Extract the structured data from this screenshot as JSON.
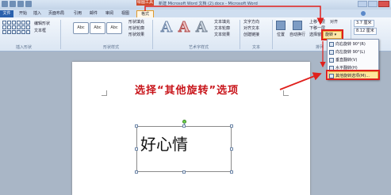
{
  "window": {
    "context_tab": "绘图工具",
    "title": "新建 Microsoft Word 文档 (2).docx - Microsoft Word"
  },
  "tabs": {
    "file": "文件",
    "home": "开始",
    "insert": "插入",
    "page_layout": "页面布局",
    "references": "引用",
    "mailings": "邮件",
    "review": "审阅",
    "view": "视图",
    "format": "格式"
  },
  "ribbon": {
    "insert_shapes": {
      "label": "插入形状",
      "edit_shape": "编辑形状",
      "text_box": "文本框"
    },
    "shape_styles": {
      "label": "形状样式",
      "presets": [
        "Abc",
        "Abc",
        "Abc"
      ],
      "fill": "形状填充",
      "outline": "形状轮廓",
      "effects": "形状效果"
    },
    "wordart_styles": {
      "label": "艺术字样式",
      "letters": [
        "A",
        "A",
        "A"
      ],
      "text_fill": "文本填充",
      "text_outline": "文本轮廓",
      "text_effects": "文本效果"
    },
    "text": {
      "label": "文本",
      "direction": "文字方向",
      "align": "对齐文本",
      "link": "创建链接"
    },
    "arrange": {
      "label": "排列",
      "position": "位置",
      "wrap": "自动换行",
      "bring_forward": "上移一层",
      "send_backward": "下移一层",
      "selection_pane": "选择窗格",
      "align": "对齐",
      "rotate": "旋转"
    },
    "size": {
      "height": "3.7 厘米",
      "width": "8.12 厘米"
    }
  },
  "rotate_menu": {
    "items": [
      "向右旋转 90°(R)",
      "向左旋转 90°(L)",
      "垂直翻转(V)",
      "水平翻转(H)",
      "其他旋转选项(M)..."
    ]
  },
  "document": {
    "instruction": "选择“其他旋转”选项",
    "textbox_text": "好心情"
  },
  "colors": {
    "annotation_red": "#e0201c",
    "highlight": "#ffe79c",
    "file_tab": "#2a61ad"
  }
}
